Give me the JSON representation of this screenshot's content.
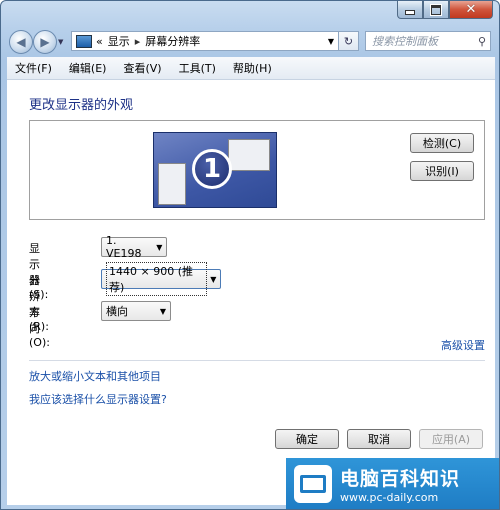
{
  "window": {
    "min_icon": "minimize-icon",
    "max_icon": "maximize-icon",
    "close_icon": "close-icon"
  },
  "nav": {
    "back_icon": "back-arrow-icon",
    "forward_icon": "forward-arrow-icon",
    "breadcrumb_prefix": "«",
    "breadcrumb": [
      "显示",
      "屏幕分辨率"
    ],
    "search_placeholder": "搜索控制面板"
  },
  "menu": [
    "文件(F)",
    "编辑(E)",
    "查看(V)",
    "工具(T)",
    "帮助(H)"
  ],
  "page": {
    "heading": "更改显示器的外观",
    "monitor_number": "1",
    "detect_label": "检测(C)",
    "identify_label": "识别(I)",
    "display_label": "显示器(S):",
    "display_value": "1. VE198",
    "resolution_label": "分辨率(R):",
    "resolution_value": "1440 × 900 (推荐)",
    "orientation_label": "方向(O):",
    "orientation_value": "横向",
    "advanced_link": "高级设置",
    "text_size_link": "放大或缩小文本和其他项目",
    "which_display_link": "我应该选择什么显示器设置?",
    "ok_label": "确定",
    "cancel_label": "取消",
    "apply_label": "应用(A)"
  },
  "watermark": {
    "title": "电脑百科知识",
    "url": "www.pc-daily.com"
  }
}
